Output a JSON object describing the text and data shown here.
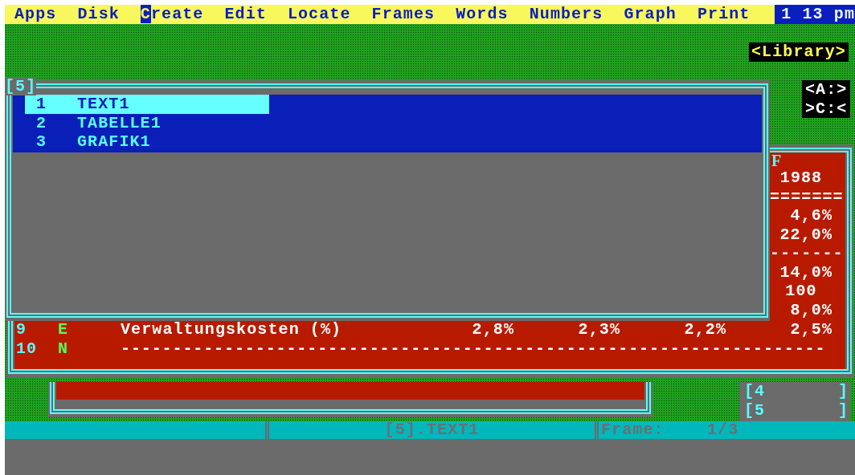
{
  "menu_bar": {
    "items": [
      {
        "label": "Apps",
        "selected": false
      },
      {
        "label": "Disk",
        "selected": false
      },
      {
        "label": "Create",
        "selected": true
      },
      {
        "label": "Edit",
        "selected": false
      },
      {
        "label": "Locate",
        "selected": false
      },
      {
        "label": "Frames",
        "selected": false
      },
      {
        "label": "Words",
        "selected": false
      },
      {
        "label": "Numbers",
        "selected": false
      },
      {
        "label": "Graph",
        "selected": false
      },
      {
        "label": "Print",
        "selected": false
      }
    ],
    "clock": "1 13 pm"
  },
  "library_label": "<Library>",
  "drives": [
    "<A:>",
    ">C:<"
  ],
  "spreadsheet": {
    "column_header": "F",
    "column_f": [
      {
        "kind": "number",
        "text": "1988"
      },
      {
        "kind": "rule",
        "text": "======="
      },
      {
        "kind": "value",
        "text": "4,6%"
      },
      {
        "kind": "value",
        "text": "22,0%"
      },
      {
        "kind": "rule",
        "text": "-------"
      },
      {
        "kind": "value",
        "text": "14,0%"
      },
      {
        "kind": "number",
        "text": "100"
      },
      {
        "kind": "value",
        "text": "8,0%"
      }
    ],
    "rows": [
      {
        "number": "9",
        "type": "E",
        "label": "Verwaltungskosten (%)",
        "values": [
          "2,8%",
          "2,3%",
          "2,2%",
          "2,5%"
        ]
      },
      {
        "number": "10",
        "type": "N",
        "label": "--------------------------------------------------------------------"
      }
    ]
  },
  "library_window": {
    "title": "[5]",
    "items": [
      {
        "number": "1",
        "name": "TEXT1",
        "selected": true
      },
      {
        "number": "2",
        "name": "TABELLE1",
        "selected": false
      },
      {
        "number": "3",
        "name": "GRAFIK1",
        "selected": false
      }
    ]
  },
  "frame_list": [
    {
      "label": "[4",
      "end": "]"
    },
    {
      "label": "[5",
      "end": "]"
    }
  ],
  "status_bar": {
    "segment_2": "[5].TEXT1",
    "frame_label": "Frame:",
    "frame_value": "1/3"
  }
}
